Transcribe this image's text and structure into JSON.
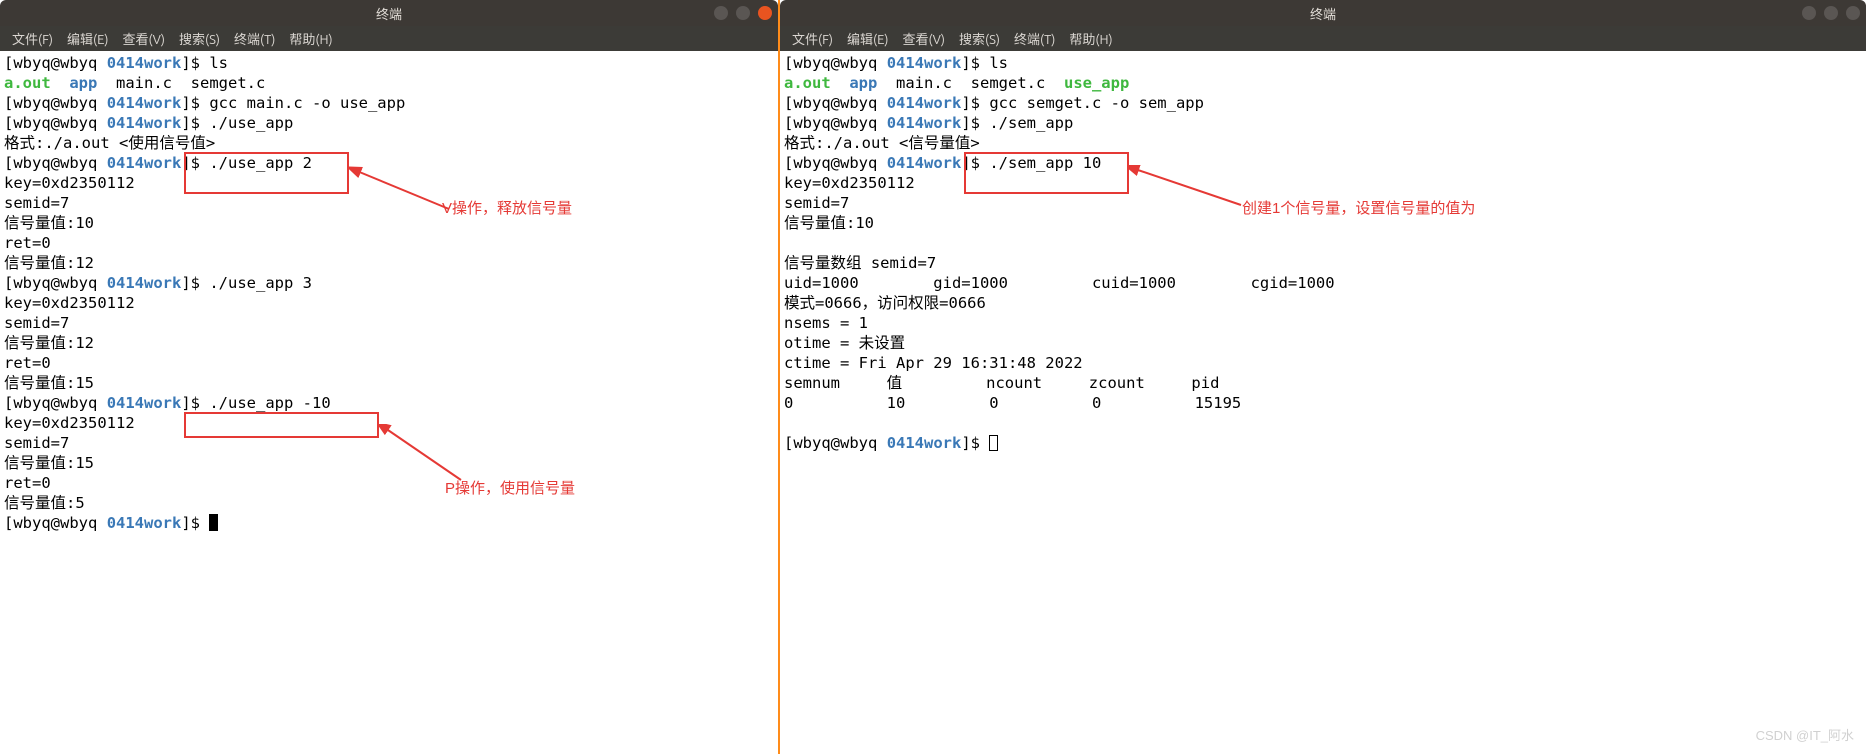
{
  "windows": {
    "left": {
      "title": "终端",
      "menus": [
        "文件(F)",
        "编辑(E)",
        "查看(V)",
        "搜索(S)",
        "终端(T)",
        "帮助(H)"
      ],
      "prompt": {
        "userhost": "wbyq@wbyq",
        "path": "0414work",
        "sep": "]$ "
      },
      "ls_items": [
        {
          "name": "a.out",
          "cls": "ls-exec"
        },
        {
          "name": "app",
          "cls": "ls-dir"
        },
        {
          "name": "main.c",
          "cls": ""
        },
        {
          "name": "semget.c",
          "cls": ""
        }
      ],
      "lines": {
        "cmd_ls": "ls",
        "cmd_gcc": "gcc main.c -o use_app",
        "cmd_run0": "./use_app",
        "usage": "格式:./a.out <使用信号值>",
        "cmd_run1": "./use_app 2",
        "key": "key=0xd2350112",
        "semid": "semid=7",
        "val10": "信号量值:10",
        "ret0": "ret=0",
        "val12": "信号量值:12",
        "cmd_run2": "./use_app 3",
        "val12b": "信号量值:12",
        "val15": "信号量值:15",
        "cmd_run3": "./use_app -10",
        "val15b": "信号量值:15",
        "val5": "信号量值:5"
      }
    },
    "right": {
      "title": "终端",
      "menus": [
        "文件(F)",
        "编辑(E)",
        "查看(V)",
        "搜索(S)",
        "终端(T)",
        "帮助(H)"
      ],
      "prompt": {
        "userhost": "wbyq@wbyq",
        "path": "0414work",
        "sep": "]$ "
      },
      "ls_items": [
        {
          "name": "a.out",
          "cls": "ls-exec"
        },
        {
          "name": "app",
          "cls": "ls-dir"
        },
        {
          "name": "main.c",
          "cls": ""
        },
        {
          "name": "semget.c",
          "cls": ""
        },
        {
          "name": "use_app",
          "cls": "ls-exec"
        }
      ],
      "lines": {
        "cmd_ls": "ls",
        "cmd_gcc": "gcc semget.c -o sem_app",
        "cmd_run0": "./sem_app",
        "usage": "格式:./a.out <信号量值>",
        "cmd_run1": "./sem_app 10",
        "key": "key=0xd2350112",
        "semid": "semid=7",
        "val10": "信号量值:10",
        "blank": "",
        "array": "信号量数组 semid=7",
        "ids": "uid=1000        gid=1000         cuid=1000        cgid=1000",
        "mode": "模式=0666，访问权限=0666",
        "nsems": "nsems = 1",
        "otime": "otime = 未设置",
        "ctime": "ctime = Fri Apr 29 16:31:48 2022",
        "header": "semnum     值         ncount     zcount     pid",
        "row": "0          10         0          0          15195"
      }
    }
  },
  "annotations": {
    "left_v": "V操作，释放信号量",
    "left_p": "P操作，使用信号量",
    "right_create": "创建1个信号量，设置信号量的值为"
  },
  "watermark": "CSDN @IT_阿水"
}
